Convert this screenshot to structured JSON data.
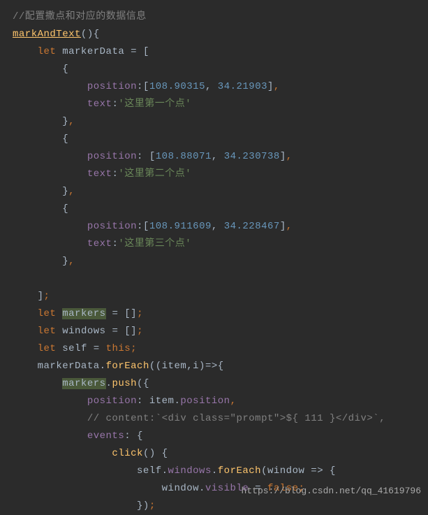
{
  "code": {
    "comment1": "//配置撒点和对应的数据信息",
    "methodName": "markAndText",
    "methodSuffix": "(){",
    "let": "let",
    "markerDataDecl": " markerData = [",
    "openBrace": "{",
    "position": "position",
    "text": "text",
    "coords1a": "108.90315",
    "coords1b": "34.21903",
    "text1": "'这里第一个点'",
    "coords2a": "108.88071",
    "coords2b": "34.230738",
    "text2": "'这里第二个点'",
    "coords3a": "108.911609",
    "coords3b": "34.228467",
    "text3": "'这里第三个点'",
    "closeBraceComma": "}",
    "comma": ",",
    "closeArray": "]",
    "semicolon": ";",
    "markers": "markers",
    "windows": "windows",
    "self": "self",
    "thisKw": "this",
    "emptyArray": " = []",
    "markerDataVar": "markerData.",
    "forEach": "forEach",
    "forEachArgs": "((item,i)=>{",
    "push": "push",
    "pushArgs": "({",
    "positionKey": "position",
    "itemPosition": ": item.",
    "positionVal": "position",
    "commentContent": "// content:`<div class=\"prompt\">${ 111 }</div>`,",
    "events": "events",
    "eventsColon": ": {",
    "click": "click",
    "clickParens": "() {",
    "selfPrefix": "self.",
    "windowsProp": "windows",
    "dotForEach": ".",
    "windowArrow": "(window => {",
    "windowVar": "window.",
    "visible": "visible",
    "equals": " = ",
    "false": "false",
    "closeArrowFn": "})"
  },
  "watermark": "https://blog.csdn.net/qq_41619796"
}
